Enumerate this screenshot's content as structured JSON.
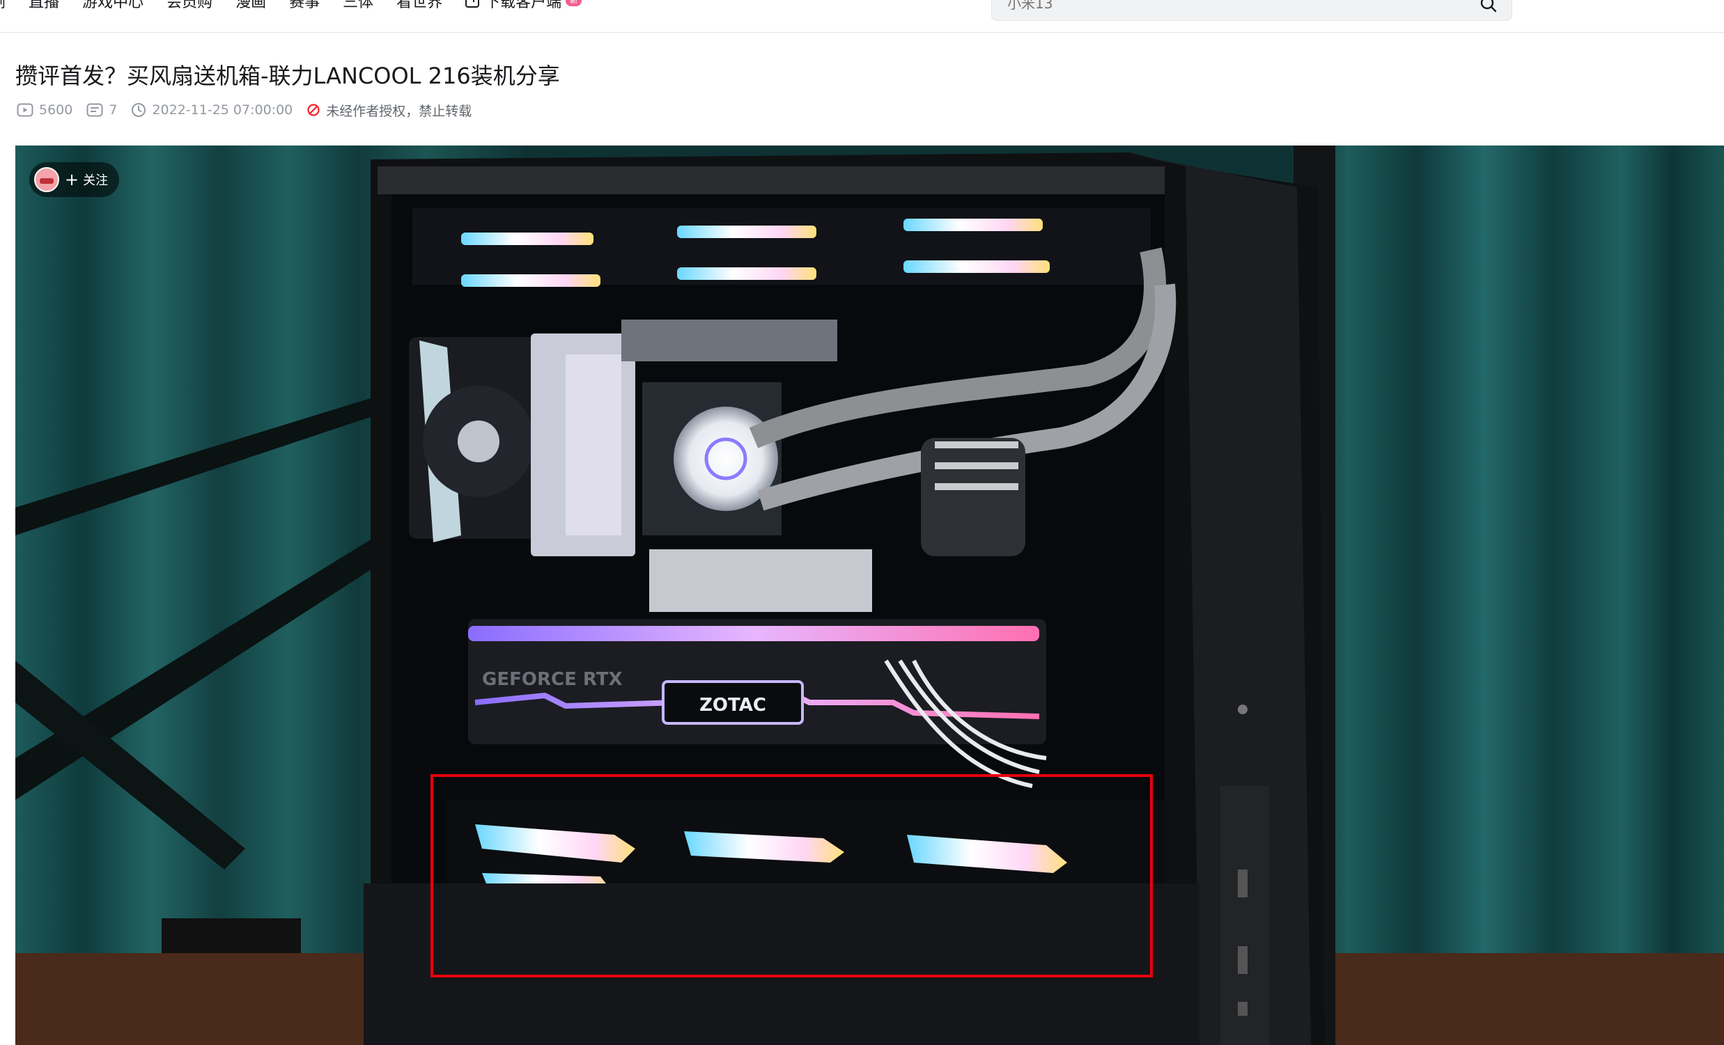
{
  "nav": {
    "items": [
      "剧",
      "直播",
      "游戏中心",
      "会员购",
      "漫画",
      "赛事",
      "三体",
      "看世界"
    ],
    "download_label": "下载客户端",
    "download_badge": "新"
  },
  "search": {
    "placeholder": "小米13"
  },
  "video": {
    "title": "攒评首发？买风扇送机箱-联力LANCOOL 216装机分享",
    "views": "5600",
    "comments": "7",
    "datetime": "2022-11-25 07:00:00",
    "copyright_notice": "未经作者授权，禁止转载"
  },
  "player": {
    "follow_label": "关注",
    "brand_text": "ZOTAC",
    "gpu_text": "GEFORCE RTX",
    "highlight_color": "#e8000b"
  }
}
